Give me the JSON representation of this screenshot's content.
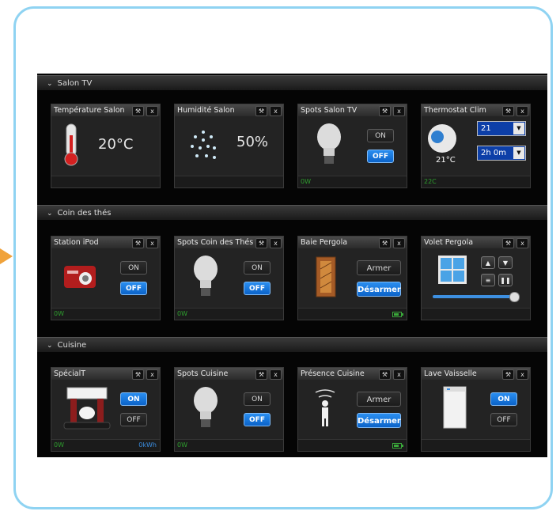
{
  "sections": [
    {
      "title": "Salon TV"
    },
    {
      "title": "Coin des thés"
    },
    {
      "title": "Cuisine"
    }
  ],
  "tiles": {
    "temp_salon": {
      "title": "Température Salon",
      "value": "20°C"
    },
    "humid_salon": {
      "title": "Humidité Salon",
      "value": "50%"
    },
    "spots_salon": {
      "title": "Spots Salon TV",
      "on": "ON",
      "off": "OFF",
      "power": "0W"
    },
    "thermostat": {
      "title": "Thermostat Clim",
      "setpoint": "21",
      "duration": "2h 0m",
      "current": "21°C",
      "footer": "22C"
    },
    "ipod": {
      "title": "Station iPod",
      "on": "ON",
      "off": "OFF",
      "power": "0W"
    },
    "spots_the": {
      "title": "Spots Coin des Thés",
      "on": "ON",
      "off": "OFF",
      "power": "0W"
    },
    "baie": {
      "title": "Baie Pergola",
      "arm": "Armer",
      "disarm": "Désarmer"
    },
    "volet": {
      "title": "Volet Pergola",
      "position": 1.0
    },
    "special": {
      "title": "SpécialT",
      "on": "ON",
      "off": "OFF",
      "power": "0W",
      "energy": "0kWh"
    },
    "spots_cuisine": {
      "title": "Spots Cuisine",
      "on": "ON",
      "off": "OFF",
      "power": "0W"
    },
    "presence": {
      "title": "Présence Cuisine",
      "arm": "Armer",
      "disarm": "Désarmer"
    },
    "lave": {
      "title": "Lave Vaisselle",
      "on": "ON",
      "off": "OFF"
    }
  },
  "tile_buttons": {
    "settings": "🔧",
    "close": "x"
  },
  "colors": {
    "accent_blue": "#1a7de0",
    "power_green": "#2e9e2e",
    "frame_border": "#8fd3f2"
  }
}
